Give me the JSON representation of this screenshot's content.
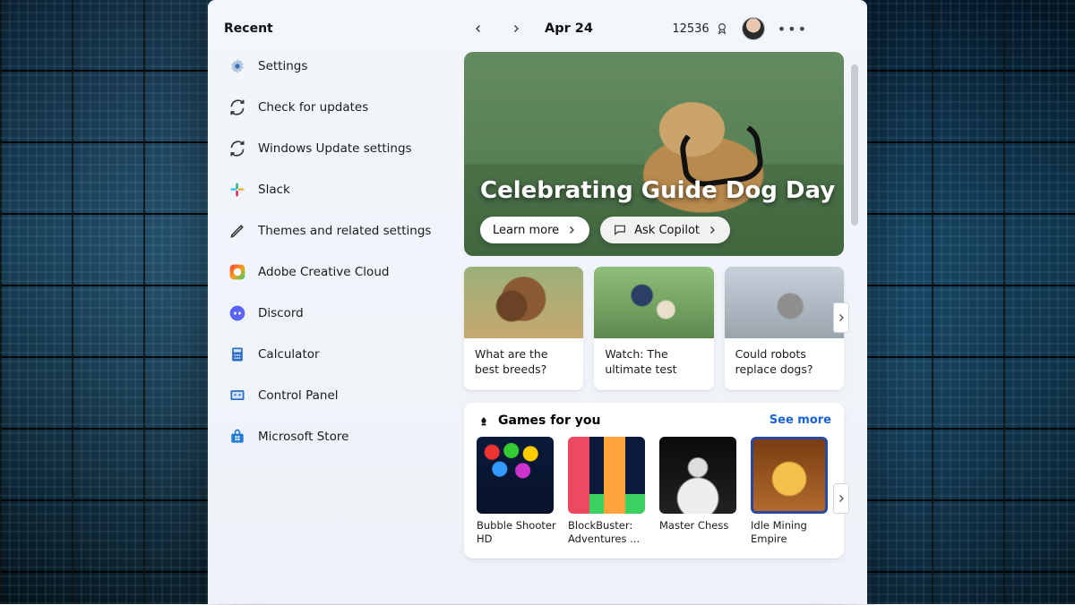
{
  "sidebar": {
    "heading": "Recent",
    "items": [
      {
        "label": "Settings",
        "icon": "settings-gear-icon"
      },
      {
        "label": "Check for updates",
        "icon": "refresh-icon"
      },
      {
        "label": "Windows Update settings",
        "icon": "refresh-icon"
      },
      {
        "label": "Slack",
        "icon": "slack-icon"
      },
      {
        "label": "Themes and related settings",
        "icon": "pencil-icon"
      },
      {
        "label": "Adobe Creative Cloud",
        "icon": "adobe-cc-icon"
      },
      {
        "label": "Discord",
        "icon": "discord-icon"
      },
      {
        "label": "Calculator",
        "icon": "calculator-icon"
      },
      {
        "label": "Control Panel",
        "icon": "control-panel-icon"
      },
      {
        "label": "Microsoft Store",
        "icon": "ms-store-icon"
      }
    ]
  },
  "topbar": {
    "date": "Apr 24",
    "points": "12536"
  },
  "hero": {
    "title": "Celebrating Guide Dog Day",
    "learn_more": "Learn more",
    "ask_copilot": "Ask Copilot"
  },
  "articles": [
    {
      "title": "What are the best breeds?"
    },
    {
      "title": "Watch: The ultimate test"
    },
    {
      "title": "Could robots replace dogs?"
    }
  ],
  "games": {
    "heading": "Games for you",
    "see_more": "See more",
    "items": [
      {
        "name": "Bubble Shooter HD"
      },
      {
        "name": "BlockBuster: Adventures ..."
      },
      {
        "name": "Master Chess"
      },
      {
        "name": "Idle Mining Empire"
      }
    ]
  }
}
